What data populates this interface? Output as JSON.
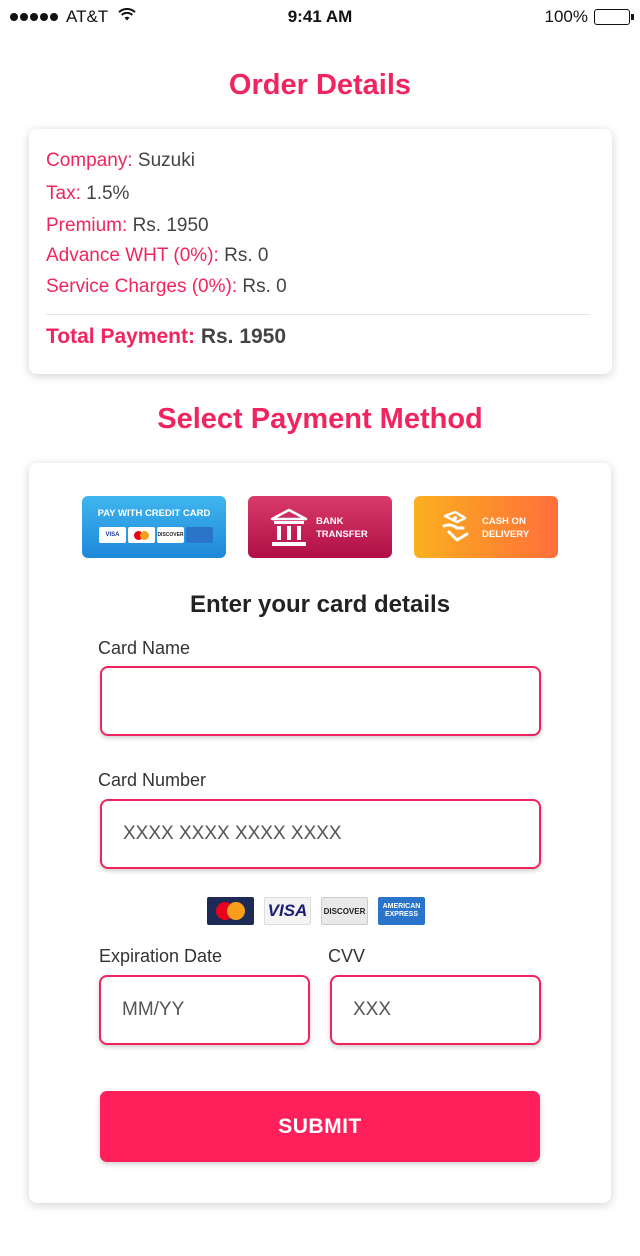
{
  "status_bar": {
    "carrier": "AT&T",
    "time": "9:41 AM",
    "battery": "100%"
  },
  "order_details": {
    "title": "Order Details",
    "rows": [
      {
        "label": "Company:",
        "value": "Suzuki"
      },
      {
        "label": "Tax:",
        "value": "1.5%"
      },
      {
        "label": "Premium:",
        "value": "Rs. 1950"
      },
      {
        "label": "Advance WHT (0%):",
        "value": "Rs. 0"
      },
      {
        "label": "Service Charges (0%):",
        "value": "Rs. 0"
      }
    ],
    "total_label": "Total Payment:",
    "total_value": "Rs. 1950"
  },
  "payment": {
    "title": "Select Payment Method",
    "methods": [
      {
        "label": "PAY WITH CREDIT CARD",
        "icon": "credit-cards-icon",
        "color": "#2a9be6"
      },
      {
        "line1": "BANK",
        "line2": "TRANSFER",
        "icon": "bank-icon",
        "color": "#c81d52"
      },
      {
        "line1": "CASH ON",
        "line2": "DELIVERY",
        "icon": "cash-delivery-icon",
        "color": "#fd8a2e"
      }
    ],
    "mini_cards": [
      "VISA",
      "DISCOVER"
    ],
    "heading": "Enter your card details",
    "card_name": {
      "label": "Card Name",
      "value": "",
      "placeholder": ""
    },
    "card_number": {
      "label": "Card Number",
      "value": "",
      "placeholder": "XXXX XXXX XXXX XXXX"
    },
    "brands": [
      "MasterCard",
      "VISA",
      "DISCOVER",
      "AMERICAN EXPRESS"
    ],
    "expiry": {
      "label": "Expiration Date",
      "value": "",
      "placeholder": "MM/YY"
    },
    "cvv": {
      "label": "CVV",
      "value": "",
      "placeholder": "XXX"
    },
    "submit_label": "SUBMIT"
  },
  "colors": {
    "accent": "#f0255f",
    "submit": "#ff1f5a"
  }
}
